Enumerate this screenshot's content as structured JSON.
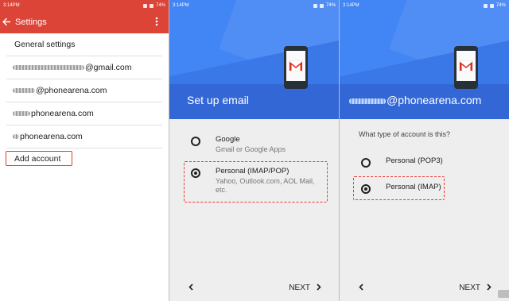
{
  "statusbar": {
    "time": "3:14PM",
    "battery": "74%"
  },
  "settings_panel": {
    "title": "Settings",
    "items": [
      {
        "label": "General settings"
      },
      {
        "label": "@gmail.com"
      },
      {
        "label": "@phonearena.com"
      },
      {
        "label": "phonearena.com"
      },
      {
        "label": "phonearena.com"
      }
    ],
    "add_account": "Add account"
  },
  "setup_panel": {
    "hero_title": "Set up email",
    "options": [
      {
        "title": "Google",
        "subtitle": "Gmail or Google Apps",
        "selected": false
      },
      {
        "title": "Personal (IMAP/POP)",
        "subtitle": "Yahoo, Outlook.com, AOL Mail, etc.",
        "selected": true
      }
    ],
    "next_label": "NEXT"
  },
  "account_type_panel": {
    "hero_title": "@phonearena.com",
    "question": "What type of account is this?",
    "options": [
      {
        "title": "Personal (POP3)",
        "selected": false
      },
      {
        "title": "Personal (IMAP)",
        "selected": true
      }
    ],
    "next_label": "NEXT"
  },
  "colors": {
    "red_bar": "#db4437",
    "blue_hero": "#4285f4",
    "highlight": "#e53935"
  },
  "icons": [
    "back-arrow-icon",
    "overflow-menu-icon",
    "gmail-phone-icon",
    "chevron-left-icon",
    "chevron-right-icon"
  ]
}
